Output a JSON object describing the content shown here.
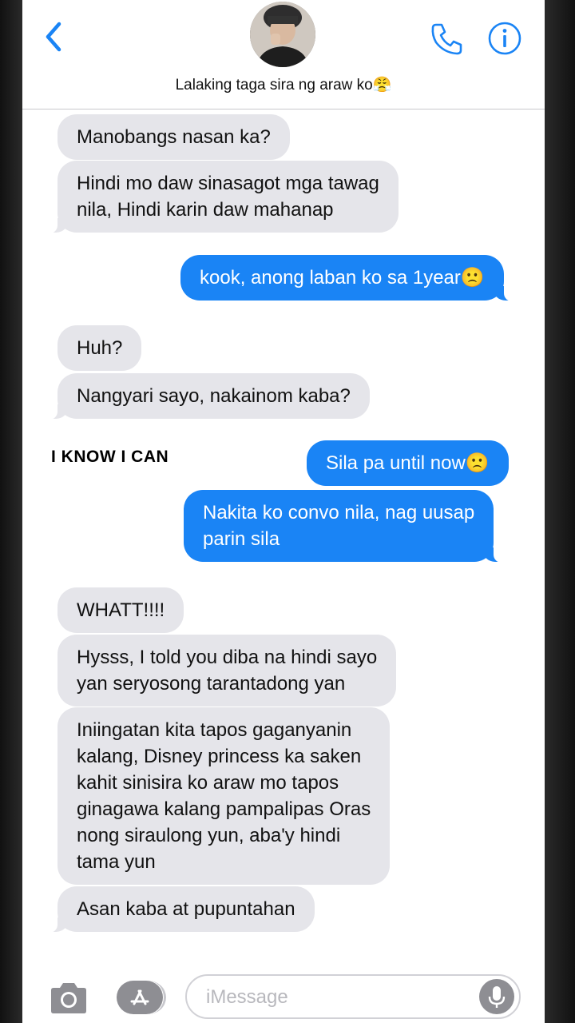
{
  "header": {
    "contact_name": "Lalaking taga sira ng araw ko😤",
    "back_icon": "chevron-left-icon",
    "call_icon": "phone-icon",
    "info_icon": "info-icon",
    "accent": "#1a84f5"
  },
  "messages": [
    {
      "direction": "incoming",
      "text": "Manobangs nasan ka?"
    },
    {
      "direction": "incoming",
      "text": "Hindi mo daw sinasagot mga tawag\nnila, Hindi karin daw mahanap"
    },
    {
      "direction": "outgoing",
      "text": "kook, anong laban ko sa 1year🙁"
    },
    {
      "direction": "incoming",
      "text": "Huh?"
    },
    {
      "direction": "incoming",
      "text": "Nangyari sayo, nakainom kaba?"
    },
    {
      "direction": "outgoing",
      "text": "Sila pa until now🙁"
    },
    {
      "direction": "outgoing",
      "text": "Nakita ko convo nila, nag uusap\nparin sila"
    },
    {
      "direction": "incoming",
      "text": "WHATT!!!!"
    },
    {
      "direction": "incoming",
      "text": "Hysss, I told you diba na hindi sayo\nyan seryosong tarantadong yan"
    },
    {
      "direction": "incoming",
      "text": "Iniingatan kita tapos gaganyanin\nkalang, Disney princess ka saken\nkahit sinisira ko araw mo tapos\nginagawa kalang pampalipas Oras\nnong siraulong yun, aba'y hindi\ntama yun"
    },
    {
      "direction": "incoming",
      "text": "Asan kaba at pupuntahan"
    }
  ],
  "overlay_text": "I KNOW I CAN",
  "input_bar": {
    "placeholder": "iMessage",
    "camera_icon": "camera-icon",
    "apps_icon": "app-store-icon",
    "mic_icon": "microphone-icon"
  },
  "colors": {
    "incoming_bubble": "#e5e5ea",
    "outgoing_bubble": "#1a84f5"
  }
}
